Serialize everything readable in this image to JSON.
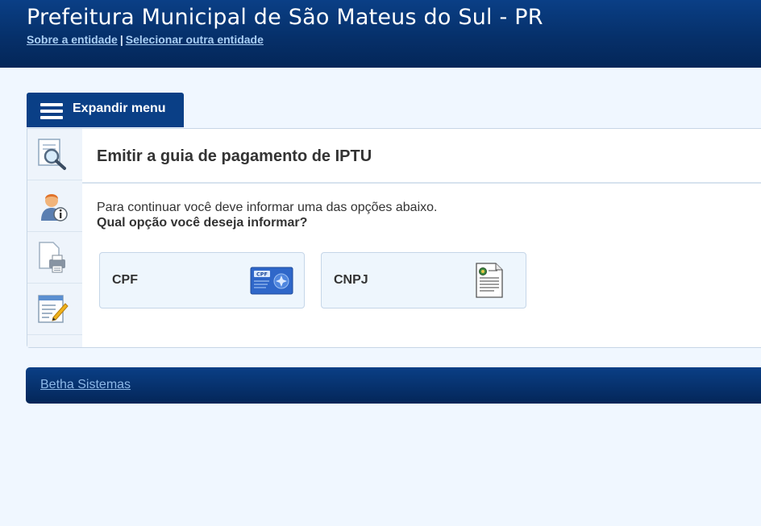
{
  "header": {
    "title": "Prefeitura Municipal de São Mateus do Sul - PR",
    "links": {
      "about": "Sobre a entidade",
      "separator": "|",
      "select_other": "Selecionar outra entidade"
    }
  },
  "menu": {
    "expand_label": "Expandir menu",
    "icon": "hamburger-icon"
  },
  "sidebar": {
    "items": [
      {
        "icon": "search-document-icon"
      },
      {
        "icon": "user-info-icon"
      },
      {
        "icon": "print-document-icon"
      },
      {
        "icon": "edit-form-icon"
      }
    ]
  },
  "main": {
    "title": "Emitir a guia de pagamento de IPTU",
    "instruction": "Para continuar você deve informar uma das opções abaixo.",
    "question": "Qual opção você deseja informar?",
    "options": [
      {
        "label": "CPF",
        "icon": "cpf-card-icon"
      },
      {
        "label": "CNPJ",
        "icon": "cnpj-document-icon"
      }
    ],
    "cpf_card_text": "CPF"
  },
  "footer": {
    "link": "Betha Sistemas"
  },
  "colors": {
    "brand": "#0a3f86",
    "link_light": "#a9cef4",
    "page_bg": "#f0f7ff"
  }
}
